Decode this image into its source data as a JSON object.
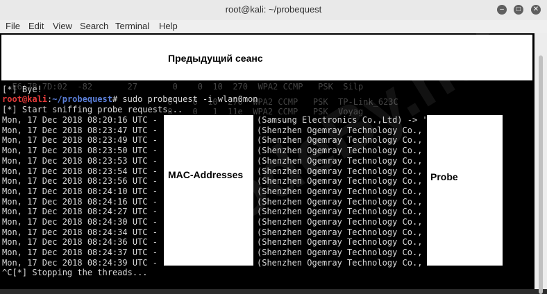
{
  "window": {
    "title": "root@kali: ~/probequest",
    "minimize_icon": "minimize-icon",
    "maximize_icon": "maximize-icon",
    "close_icon": "close-icon"
  },
  "menu": [
    "File",
    "Edit",
    "View",
    "Search",
    "Terminal",
    "Help"
  ],
  "background_scan_lines": [
    "                                              ",
    "  E6:7B:7D:02  -82       27       0    0  10  270  WPA2 CCMP   PSK  Silp",
    "                                 0    0  10  270  WPA2 CCMP   PSK  TP-Link_623C",
    "                                 0    0   1  11e  WPA2 CCMP   PSK  Voyag"
  ],
  "terminal": {
    "bye_line": "[*] Bye!",
    "prompt_user": "root@kali",
    "prompt_sep": ":",
    "prompt_path": "~/probequest",
    "prompt_symbol": "#",
    "command": " sudo probequest -i wlan0mon",
    "start_line": "[*] Start sniffing probe requests...",
    "timestamps": [
      "Mon, 17 Dec 2018 08:20:16 UTC -",
      "Mon, 17 Dec 2018 08:23:47 UTC -",
      "Mon, 17 Dec 2018 08:23:49 UTC -",
      "Mon, 17 Dec 2018 08:23:50 UTC -",
      "Mon, 17 Dec 2018 08:23:53 UTC -",
      "Mon, 17 Dec 2018 08:23:54 UTC -",
      "Mon, 17 Dec 2018 08:23:56 UTC -",
      "Mon, 17 Dec 2018 08:24:10 UTC -",
      "Mon, 17 Dec 2018 08:24:16 UTC -",
      "Mon, 17 Dec 2018 08:24:27 UTC -",
      "Mon, 17 Dec 2018 08:24:30 UTC -",
      "Mon, 17 Dec 2018 08:24:34 UTC -",
      "Mon, 17 Dec 2018 08:24:36 UTC -",
      "Mon, 17 Dec 2018 08:24:37 UTC -",
      "Mon, 17 Dec 2018 08:24:39 UTC -"
    ],
    "vendors": [
      "(Samsung Electronics Co.,Ltd) -> '",
      "(Shenzhen Ogemray Technology Co.,",
      "(Shenzhen Ogemray Technology Co.,",
      "(Shenzhen Ogemray Technology Co.,",
      "(Shenzhen Ogemray Technology Co.,",
      "(Shenzhen Ogemray Technology Co.,",
      "(Shenzhen Ogemray Technology Co.,",
      "(Shenzhen Ogemray Technology Co.,",
      "(Shenzhen Ogemray Technology Co.,",
      "(Shenzhen Ogemray Technology Co.,",
      "(Shenzhen Ogemray Technology Co.,",
      "(Shenzhen Ogemray Technology Co.,",
      "(Shenzhen Ogemray Technology Co.,",
      "(Shenzhen Ogemray Technology Co.,",
      "(Shenzhen Ogemray Technology Co.,"
    ],
    "stop_line": "^C[*] Stopping the threads..."
  },
  "overlays": {
    "previous_session": "Предыдущий сеанс",
    "mac_addresses": "MAC-Addresses",
    "probe": "Probe"
  },
  "watermark": "CodeBy.net",
  "colors": {
    "terminal_bg": "#000000",
    "prompt_user": "#e83b3b",
    "prompt_path": "#5b7fd9",
    "text": "#d8d8d8"
  }
}
